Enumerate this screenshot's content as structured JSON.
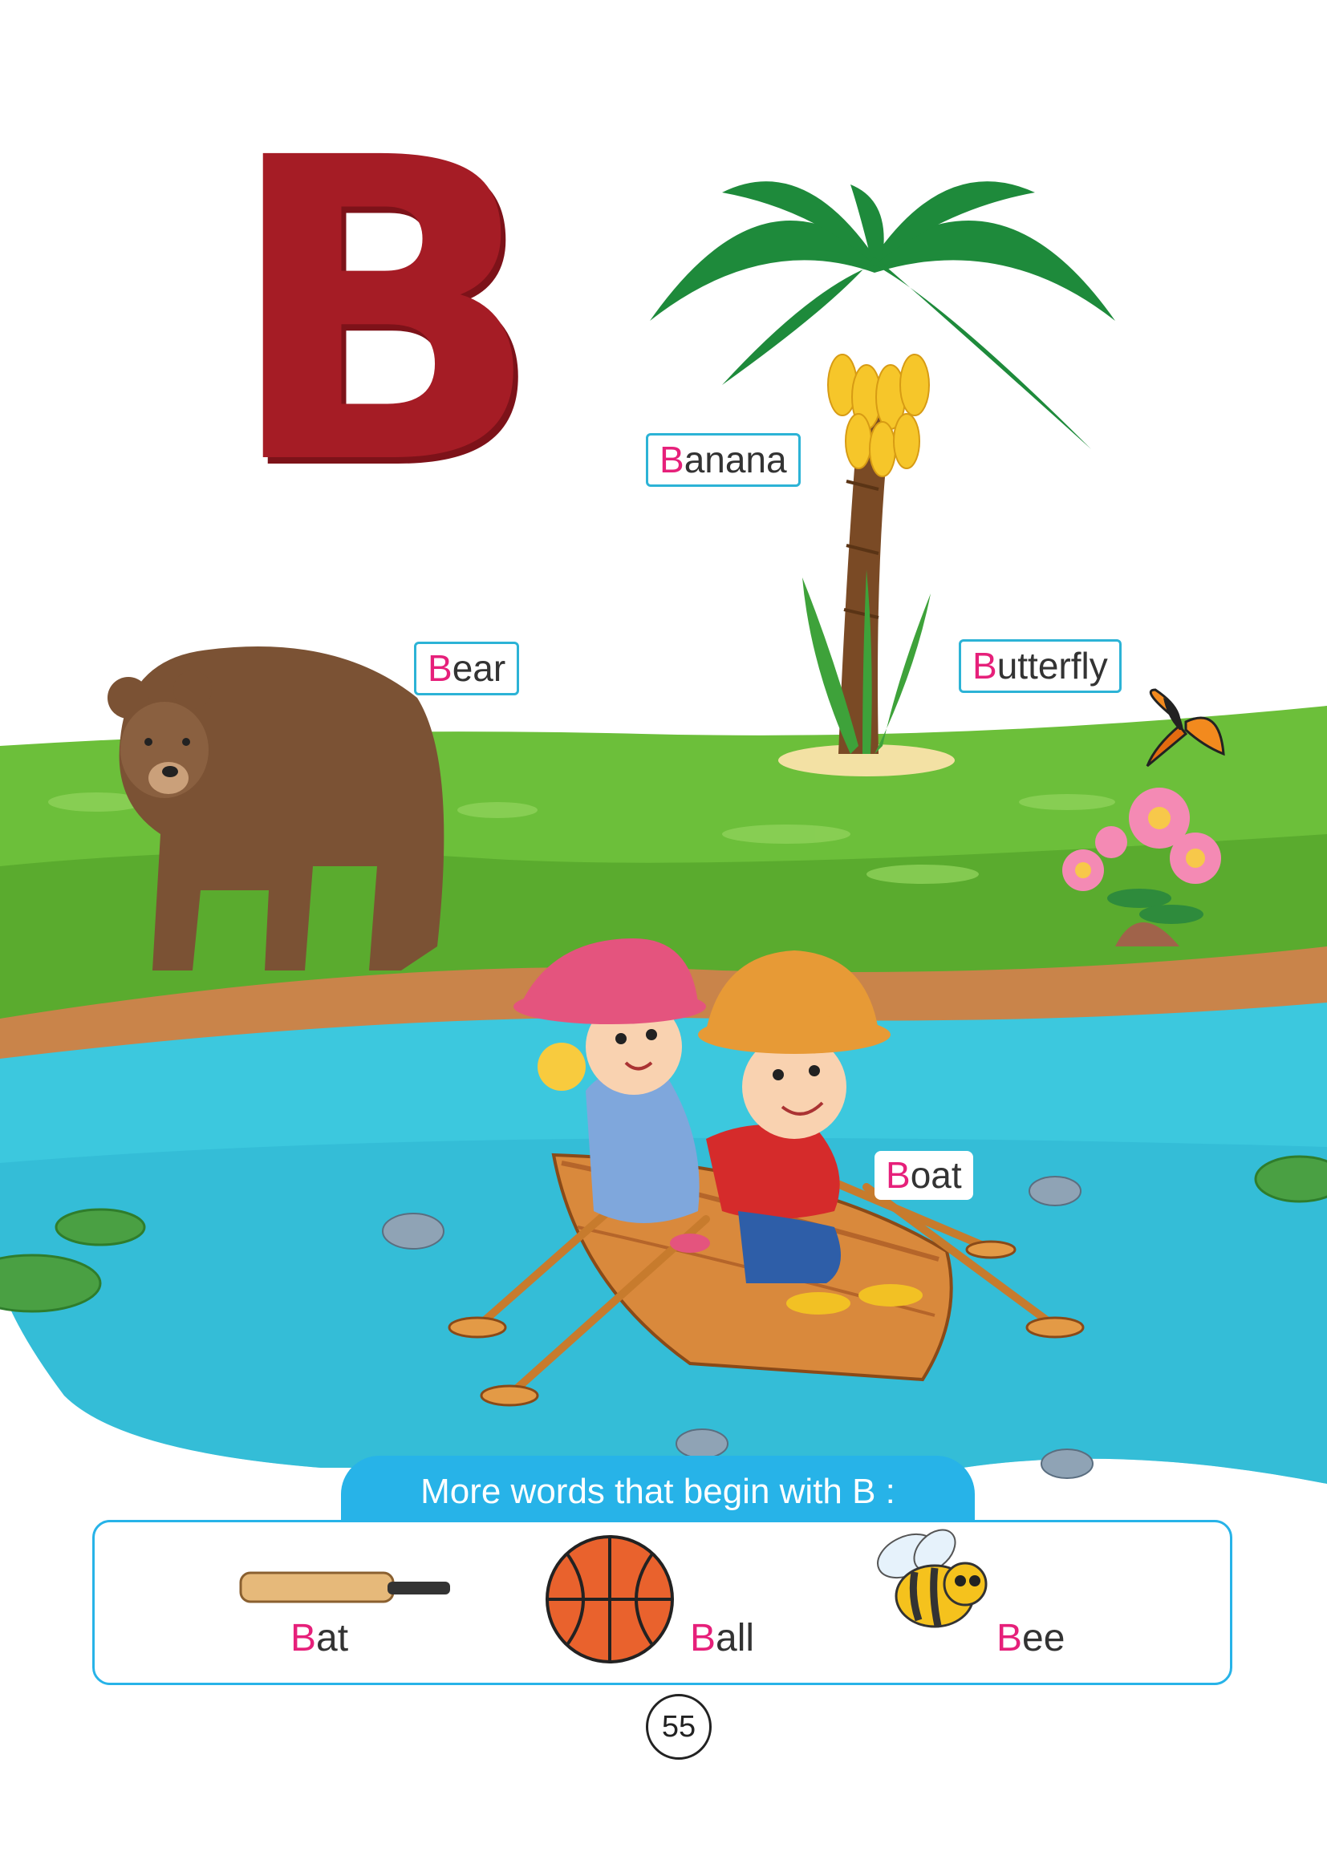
{
  "letter": "B",
  "labels": {
    "banana": {
      "first": "B",
      "rest": "anana"
    },
    "bear": {
      "first": "B",
      "rest": "ear"
    },
    "butterfly": {
      "first": "B",
      "rest": "utterfly"
    },
    "boat": {
      "first": "B",
      "rest": "oat"
    }
  },
  "more": {
    "heading": "More words that begin with B :",
    "words": [
      {
        "first": "B",
        "rest": "at",
        "icon": "bat-icon"
      },
      {
        "first": "B",
        "rest": "all",
        "icon": "ball-icon"
      },
      {
        "first": "B",
        "rest": "ee",
        "icon": "bee-icon"
      }
    ]
  },
  "page_number": "55",
  "colors": {
    "letter": "#a51c25",
    "first_letter": "#e6207a",
    "accent": "#27b3e8",
    "grass": "#6cbf3a",
    "water": "#3cc8de"
  }
}
